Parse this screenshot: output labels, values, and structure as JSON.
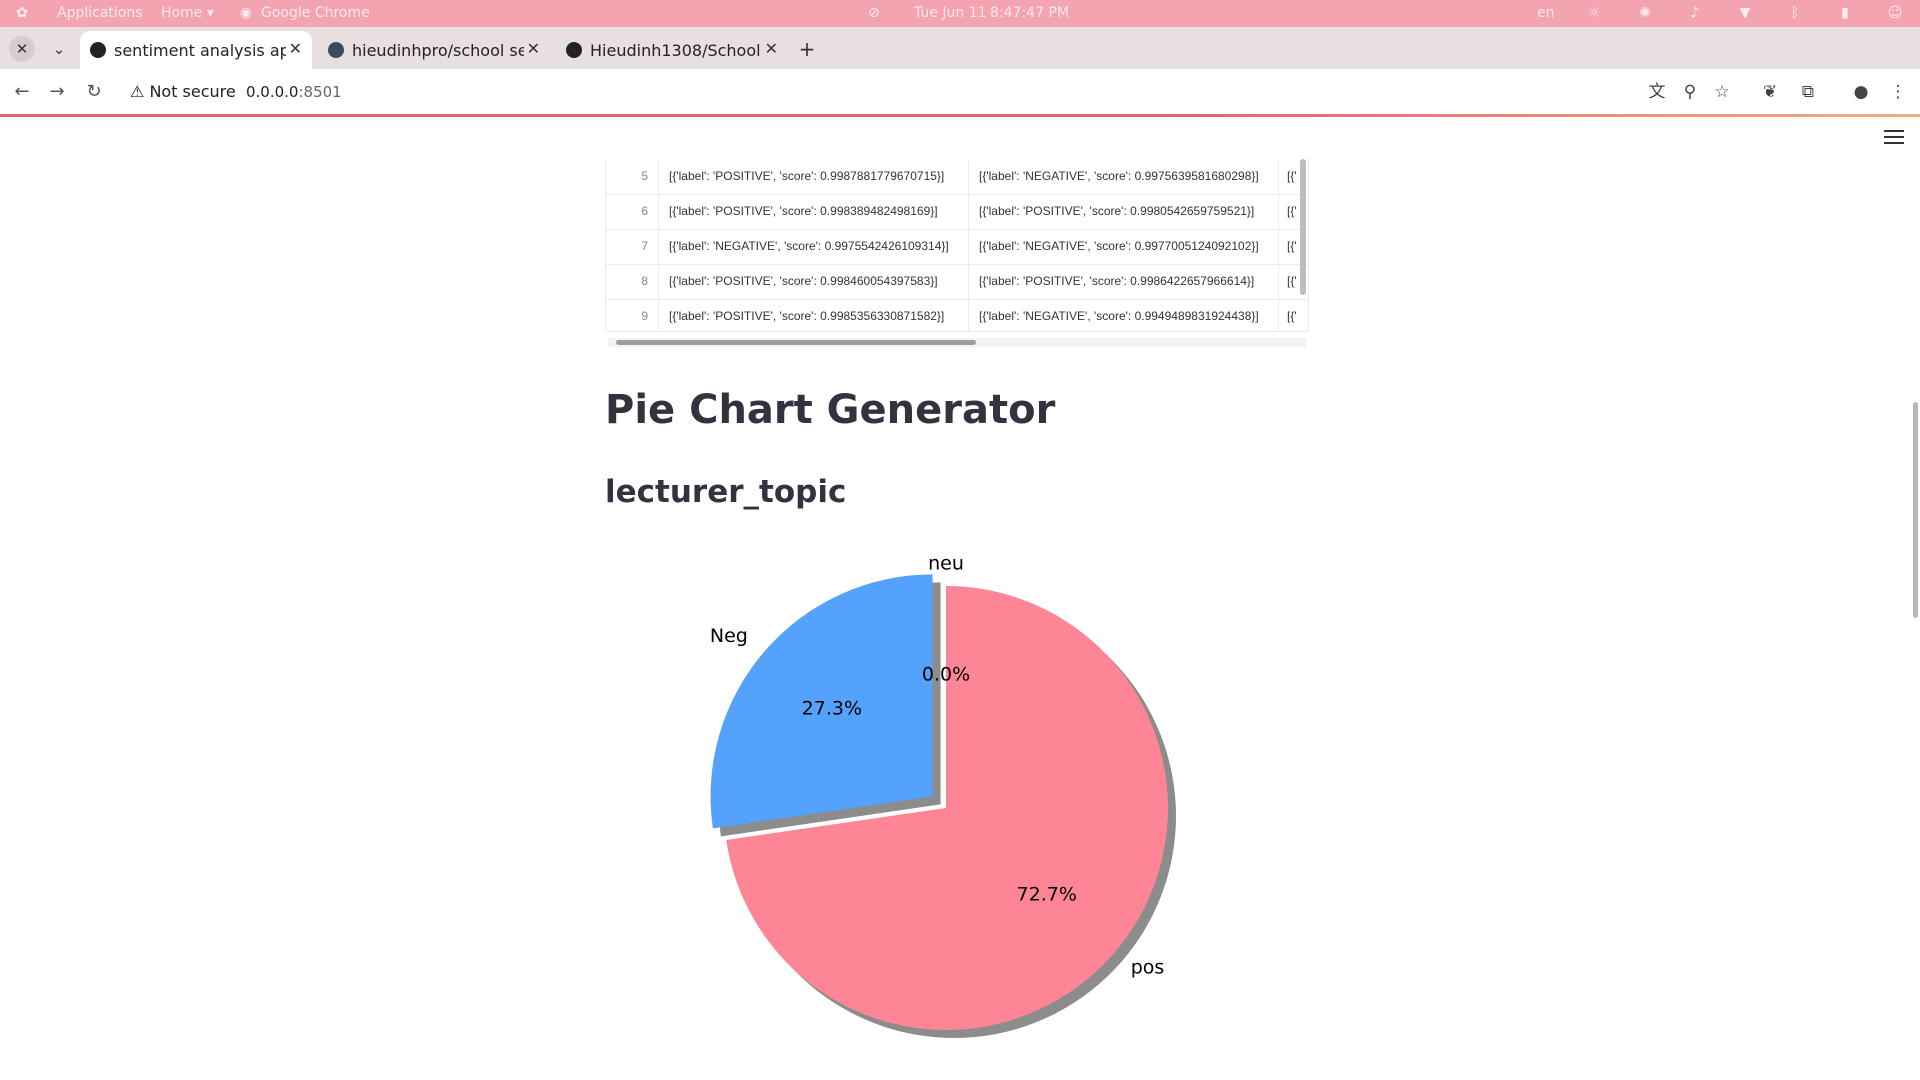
{
  "system_bar": {
    "applications": "Applications",
    "home": "Home ▾",
    "active_app": "Google Chrome",
    "date": "Tue Jun 11",
    "time": "8:47:47 PM",
    "keyboard": "en"
  },
  "tabs": [
    {
      "label": "sentiment analysis ap",
      "active": true
    },
    {
      "label": "hieudinhpro/school se",
      "active": false
    },
    {
      "label": "Hieudinh1308/School",
      "active": false
    }
  ],
  "address_bar": {
    "security_label": "Not secure",
    "host": "0.0.0.0",
    "port": ":8501"
  },
  "table": {
    "rows": [
      {
        "index": "5",
        "col1": "[{'label': 'POSITIVE', 'score': 0.9987881779670715}]",
        "col2": "[{'label': 'NEGATIVE', 'score': 0.9975639581680298}]",
        "col3": "[{'"
      },
      {
        "index": "6",
        "col1": "[{'label': 'POSITIVE', 'score': 0.998389482498169}]",
        "col2": "[{'label': 'POSITIVE', 'score': 0.9980542659759521}]",
        "col3": "[{'"
      },
      {
        "index": "7",
        "col1": "[{'label': 'NEGATIVE', 'score': 0.9975542426109314}]",
        "col2": "[{'label': 'NEGATIVE', 'score': 0.9977005124092102}]",
        "col3": "[{'"
      },
      {
        "index": "8",
        "col1": "[{'label': 'POSITIVE', 'score': 0.998460054397583}]",
        "col2": "[{'label': 'POSITIVE', 'score': 0.9986422657966614}]",
        "col3": "[{'"
      },
      {
        "index": "9",
        "col1": "[{'label': 'POSITIVE', 'score': 0.9985356330871582}]",
        "col2": "[{'label': 'NEGATIVE', 'score': 0.9949489831924438}]",
        "col3": "[{'"
      }
    ]
  },
  "page": {
    "title": "Pie Chart Generator",
    "subtitle": "lecturer_topic"
  },
  "chart_data": {
    "type": "pie",
    "categories": [
      "neu",
      "Neg",
      "pos"
    ],
    "values": [
      0.0,
      27.3,
      72.7
    ],
    "labels": [
      "0.0%",
      "27.3%",
      "72.7%"
    ],
    "colors": [
      "#a0a0a0",
      "#55a2fc",
      "#fd8595"
    ],
    "exploded": [
      "Neg"
    ],
    "shadow": true,
    "start_angle_deg": 90
  }
}
